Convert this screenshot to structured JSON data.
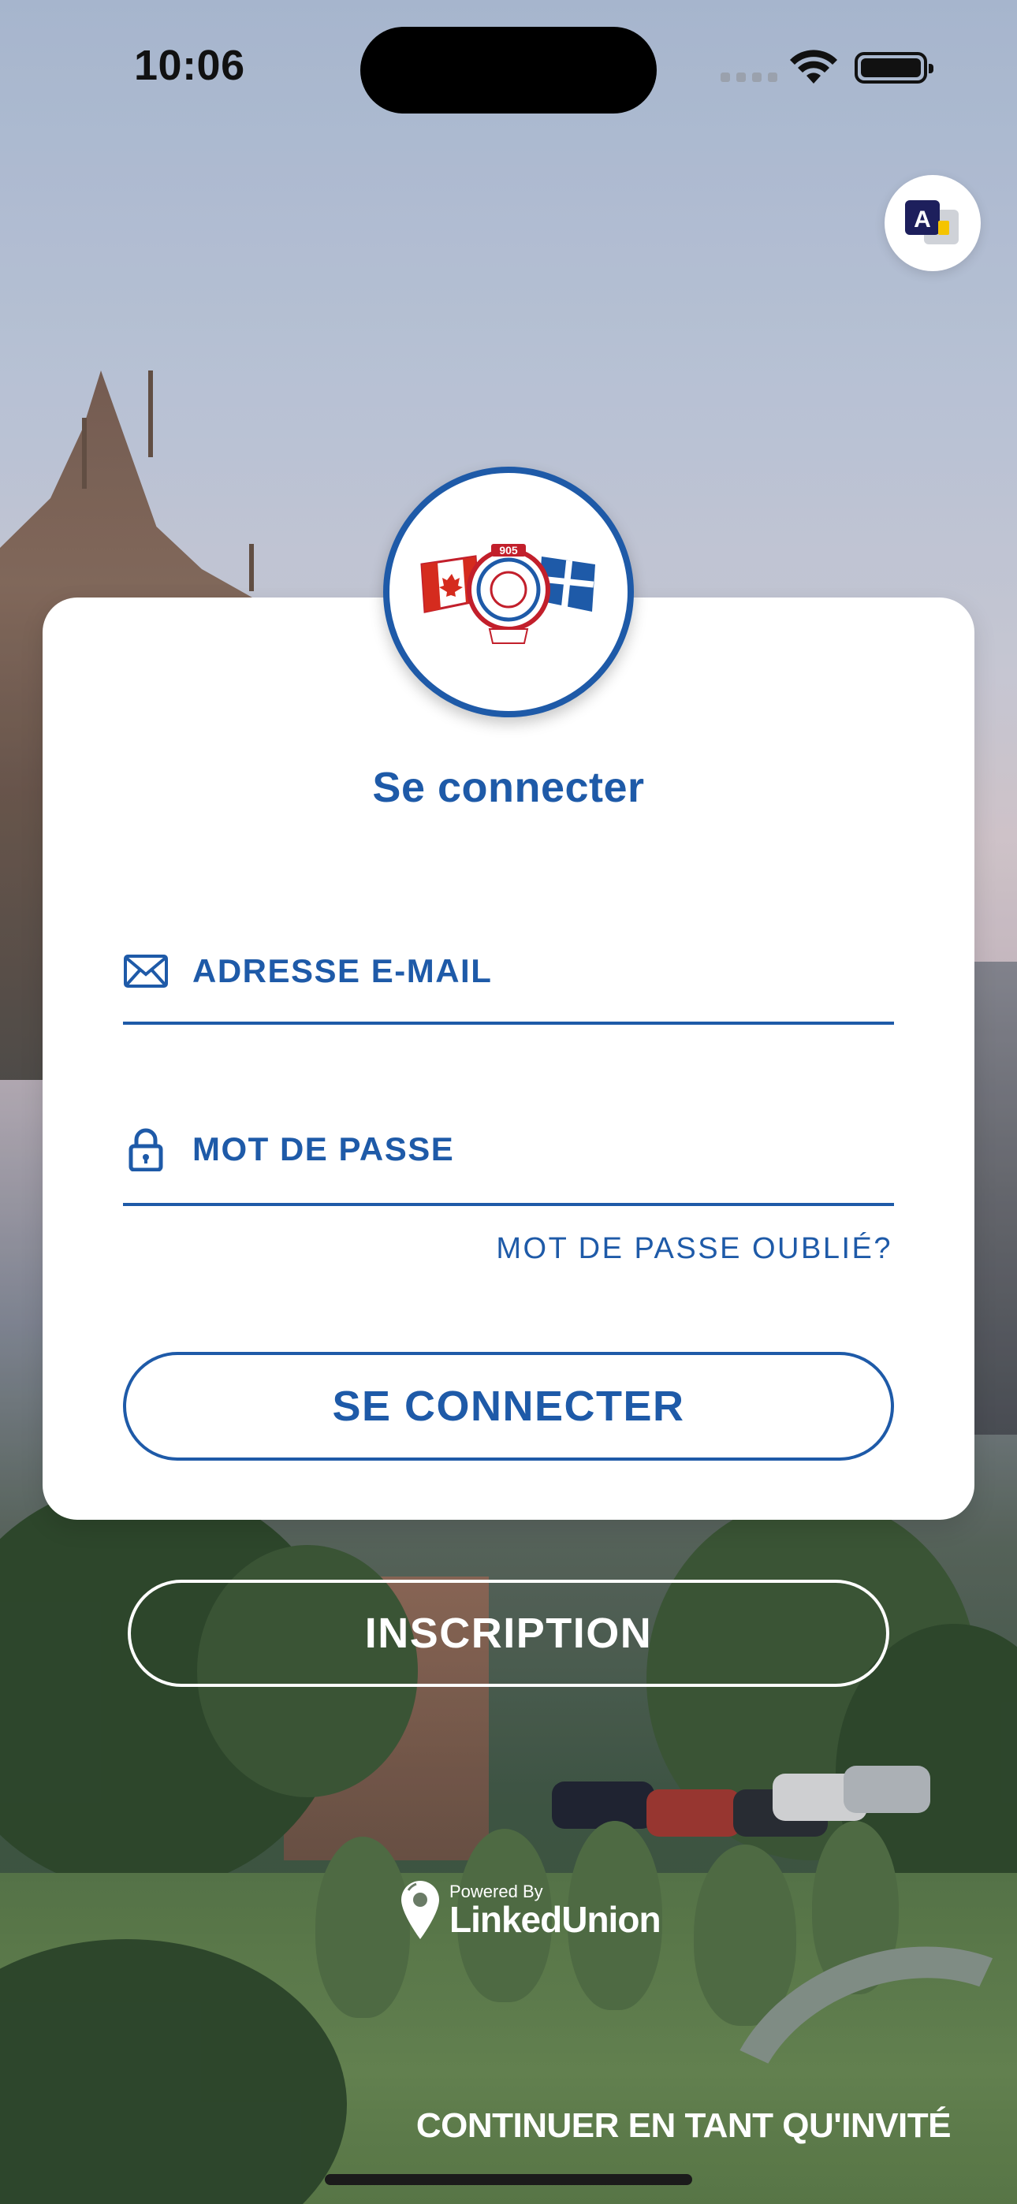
{
  "status_bar": {
    "time": "10:06"
  },
  "translate": {
    "icon": "translate-icon"
  },
  "login": {
    "title": "Se connecter",
    "email_placeholder": "ADRESSE E-MAIL",
    "password_placeholder": "MOT DE PASSE",
    "forgot_label": "MOT DE PASSE OUBLIÉ?",
    "submit_label": "SE CONNECTER"
  },
  "signup_label": "INSCRIPTION",
  "powered_by": {
    "prefix": "Powered By",
    "brand": "LinkedUnion"
  },
  "guest_label": "CONTINUER EN TANT QU'INVITÉ",
  "colors": {
    "accent": "#1e5aa8",
    "card": "#ffffff"
  }
}
